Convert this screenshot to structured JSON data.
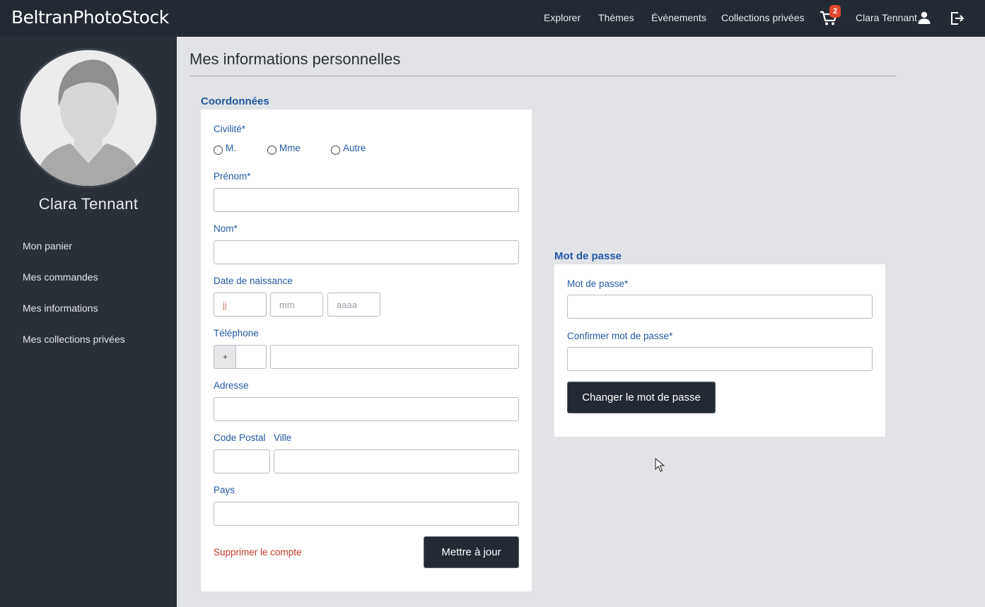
{
  "header": {
    "logo": "BeltranPhotoStock",
    "nav": [
      "Explorer",
      "Thèmes",
      "Événements",
      "Collections privées"
    ],
    "cart_count": "2",
    "user_name": "Clara Tennant"
  },
  "sidebar": {
    "user_name": "Clara Tennant",
    "items": [
      "Mon panier",
      "Mes commandes",
      "Mes informations",
      "Mes collections privées"
    ]
  },
  "main": {
    "title": "Mes informations personnelles",
    "coords": {
      "title": "Coordonnées",
      "civility_label": "Civilité*",
      "civility_options": [
        "M.",
        "Mme",
        "Autre"
      ],
      "firstname_label": "Prénom*",
      "lastname_label": "Nom*",
      "birthdate_label": "Date de naissance",
      "birth_day_placeholder": "jj",
      "birth_month_placeholder": "mm",
      "birth_year_placeholder": "aaaa",
      "phone_label": "Téléphone",
      "phone_prefix": "+",
      "address_label": "Adresse",
      "postal_label": "Code Postal",
      "city_label": "Ville",
      "country_label": "Pays",
      "delete_label": "Supprimer le compte",
      "update_label": "Mettre à jour"
    },
    "password": {
      "title": "Mot de passe",
      "password_label": "Mot de passe*",
      "confirm_label": "Confirmer mot de passe*",
      "change_label": "Changer le mot de passe"
    }
  },
  "colors": {
    "topbar": "#232a33",
    "sidebar": "#2a3038",
    "accent_blue": "#2558a3",
    "danger": "#c0392b",
    "badge": "#e0462f"
  }
}
